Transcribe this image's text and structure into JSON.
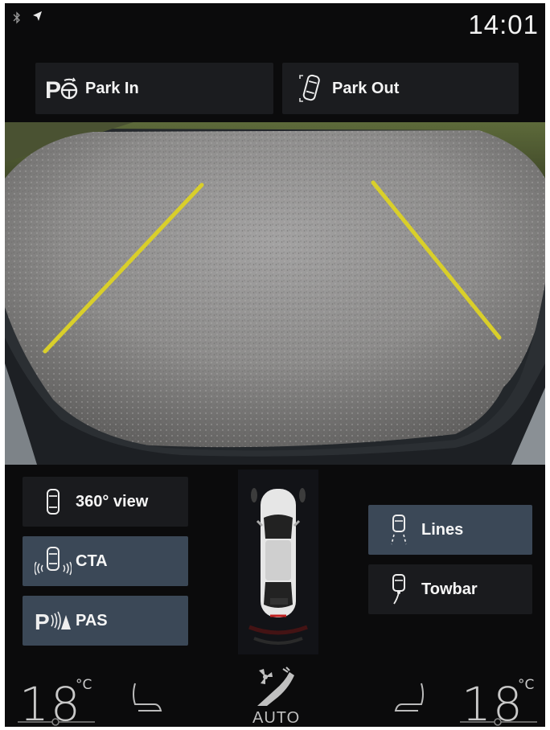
{
  "status_bar": {
    "time": "14:01",
    "icons": [
      "bluetooth-icon",
      "navigation-arrow-icon"
    ]
  },
  "parking": {
    "park_in_label": "Park In",
    "park_out_label": "Park Out"
  },
  "camera_view": {
    "guide_line_color": "#d9cf2a"
  },
  "camera_options": {
    "view_360_label": "360° view",
    "cta_label": "CTA",
    "pas_label": "PAS",
    "lines_label": "Lines",
    "towbar_label": "Towbar"
  },
  "climate": {
    "left_temp": "18",
    "left_unit": "°C",
    "right_temp": "18",
    "right_unit": "°C",
    "fan_mode": "AUTO"
  },
  "colors": {
    "active_button": "#3b4857",
    "inactive_button": "#1a1b1e",
    "background": "#0b0b0c"
  }
}
